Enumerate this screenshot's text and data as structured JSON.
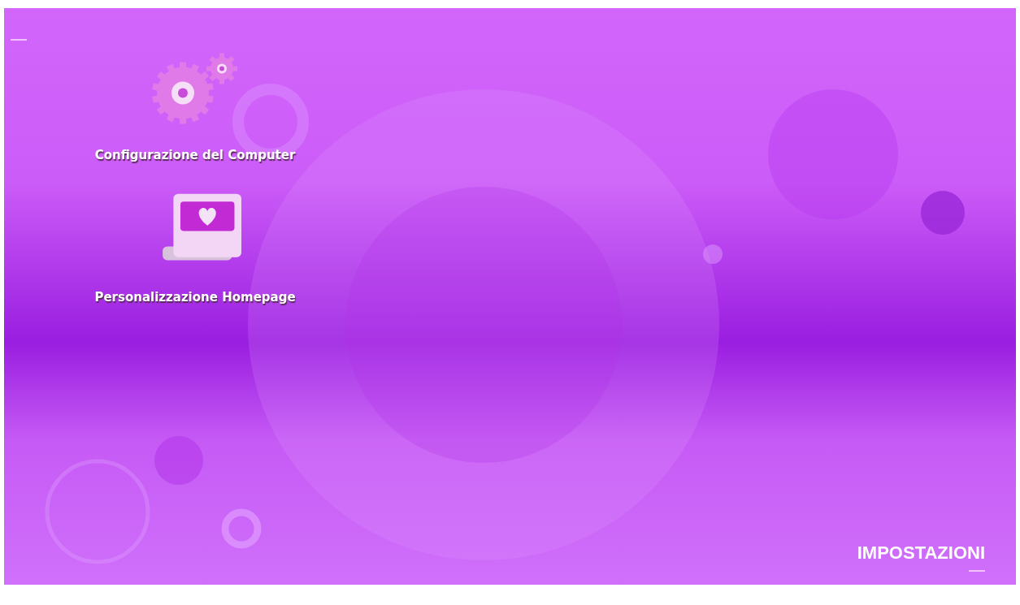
{
  "icons": [
    {
      "kind": "gears",
      "label": "Configurazione del Computer"
    },
    {
      "kind": "laptop",
      "label": "Personalizzazione Homepage"
    }
  ],
  "section_title": "IMPOSTAZIONI"
}
